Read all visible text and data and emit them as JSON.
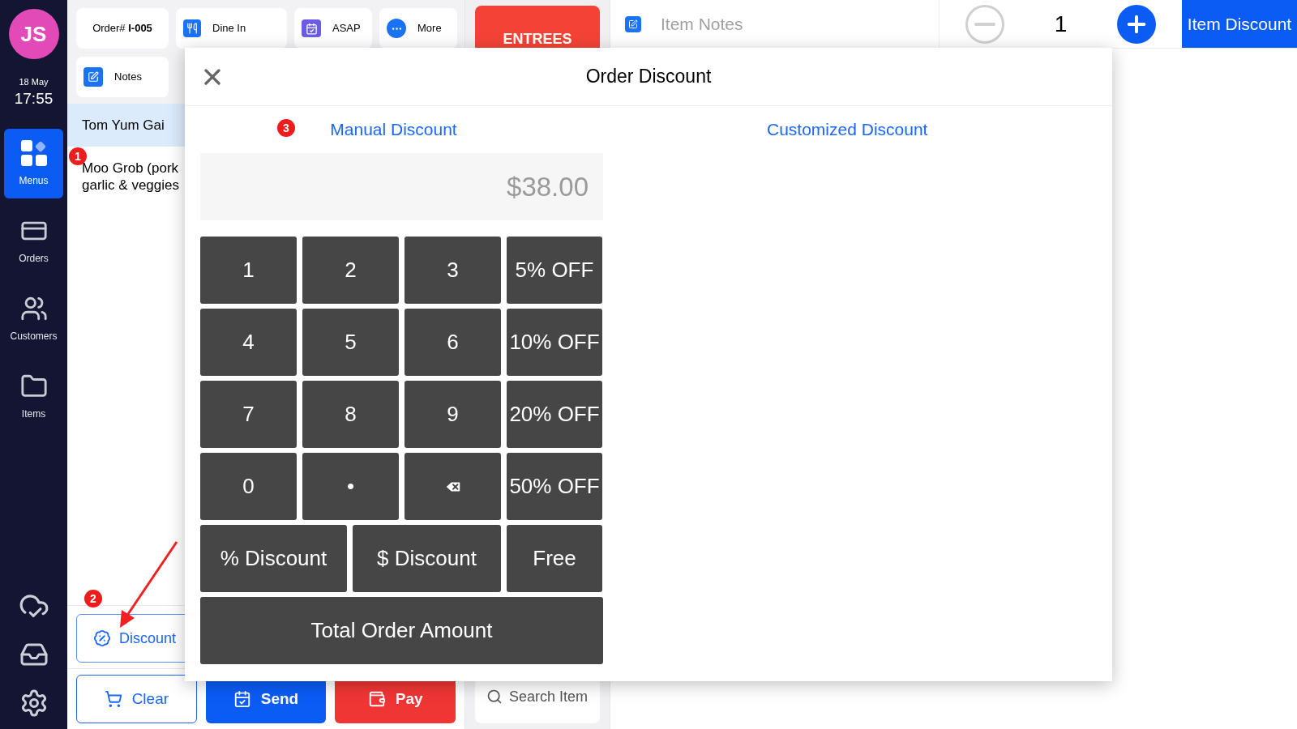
{
  "sidebar": {
    "avatar": "JS",
    "date": "18 May",
    "time": "17:55",
    "items": [
      {
        "label": "Menus",
        "kind": "menus",
        "selected": true
      },
      {
        "label": "Orders",
        "kind": "orders",
        "selected": false
      },
      {
        "label": "Customers",
        "kind": "customers",
        "selected": false
      },
      {
        "label": "Items",
        "kind": "items",
        "selected": false
      }
    ],
    "bottom_icons": [
      {
        "kind": "cloud"
      },
      {
        "kind": "cash"
      },
      {
        "kind": "settings"
      }
    ]
  },
  "order_panel": {
    "order_label": "Order#",
    "order_number": "I-005",
    "chips": [
      {
        "label": "Dine In",
        "kind": "dine"
      },
      {
        "label": "ASAP",
        "kind": "asap"
      },
      {
        "label": "More",
        "kind": "more"
      },
      {
        "label": "Notes",
        "kind": "notes"
      }
    ],
    "items": [
      {
        "lines": [
          "Tom Yum Gai"
        ],
        "selected": true
      },
      {
        "lines": [
          "Moo Grob (pork",
          "garlic & veggies"
        ],
        "selected": false
      }
    ],
    "discount_button": "Discount",
    "actions": [
      {
        "label": "Clear",
        "kind": "clear"
      },
      {
        "label": "Send",
        "kind": "send"
      },
      {
        "label": "Pay",
        "kind": "pay"
      }
    ]
  },
  "category": {
    "label": "ENTREES"
  },
  "search": {
    "placeholder": "Search Item"
  },
  "item_bar": {
    "notes_placeholder": "Item Notes",
    "quantity": "1",
    "discount_button": "Item Discount"
  },
  "annotations": [
    {
      "text": "1"
    },
    {
      "text": "2"
    },
    {
      "text": "3"
    }
  ],
  "modal": {
    "title": "Order Discount",
    "tabs": [
      "Manual Discount",
      "Customized Discount"
    ],
    "amount": "$38.00",
    "keypad": [
      [
        {
          "label": "1"
        },
        {
          "label": "2"
        },
        {
          "label": "3"
        },
        {
          "label": "5% OFF"
        }
      ],
      [
        {
          "label": "4"
        },
        {
          "label": "5"
        },
        {
          "label": "6"
        },
        {
          "label": "10% OFF"
        }
      ],
      [
        {
          "label": "7"
        },
        {
          "label": "8"
        },
        {
          "label": "9"
        },
        {
          "label": "20% OFF"
        }
      ],
      [
        {
          "label": "0"
        },
        {
          "label": "•"
        },
        {
          "kind": "backspace"
        },
        {
          "label": "50% OFF"
        }
      ],
      [
        {
          "label": "% Discount"
        },
        {
          "label": "$ Discount"
        },
        {
          "label": "Free"
        }
      ],
      [
        {
          "label": "Total Order Amount"
        }
      ]
    ]
  }
}
